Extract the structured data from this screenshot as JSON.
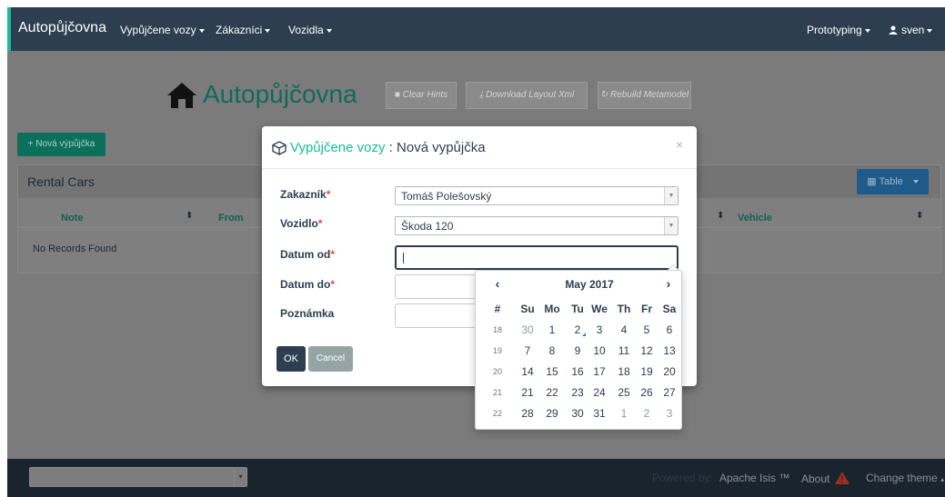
{
  "navbar": {
    "brand": "Autopůjčovna",
    "menus": [
      "Vypůjčene vozy",
      "Zákazníci",
      "Vozidla"
    ],
    "right": {
      "prototyping": "Prototyping",
      "user": "sven"
    }
  },
  "header": {
    "title": "Autopůjčovna",
    "buttons": [
      "Clear Hints",
      "Download Layout Xml",
      "Rebuild Metamodel"
    ]
  },
  "actions": {
    "nova": "Nová výpůjčka"
  },
  "panel": {
    "title": "Rental Cars",
    "view_button": "Table",
    "columns": [
      "Note",
      "From",
      "Vehicle"
    ],
    "empty": "No Records Found"
  },
  "modal": {
    "title_link": "Vypůjčene vozy",
    "title_rest": " : Nová vypůjčka",
    "close": "×",
    "fields": {
      "zakaznik": {
        "label": "Zakazník",
        "value": "Tomáš Polešovský"
      },
      "vozidlo": {
        "label": "Vozidlo",
        "value": "Škoda 120"
      },
      "datum_od": {
        "label": "Datum od",
        "value": ""
      },
      "datum_do": {
        "label": "Datum do",
        "value": ""
      },
      "poznamka": {
        "label": "Poznámka",
        "value": ""
      }
    },
    "required_mark": "*",
    "ok": "OK",
    "cancel": "Cancel"
  },
  "datepicker": {
    "month": "May 2017",
    "prev": "‹",
    "next": "›",
    "headers": [
      "#",
      "Su",
      "Mo",
      "Tu",
      "We",
      "Th",
      "Fr",
      "Sa"
    ],
    "weeks": [
      {
        "week": "18",
        "days": [
          "30",
          "1",
          "2",
          "3",
          "4",
          "5",
          "6"
        ]
      },
      {
        "week": "19",
        "days": [
          "7",
          "8",
          "9",
          "10",
          "11",
          "12",
          "13"
        ]
      },
      {
        "week": "20",
        "days": [
          "14",
          "15",
          "16",
          "17",
          "18",
          "19",
          "20"
        ]
      },
      {
        "week": "21",
        "days": [
          "21",
          "22",
          "23",
          "24",
          "25",
          "26",
          "27"
        ]
      },
      {
        "week": "22",
        "days": [
          "28",
          "29",
          "30",
          "31",
          "1",
          "2",
          "3"
        ]
      }
    ],
    "today": "2"
  },
  "footer": {
    "powered": "Powered by:",
    "apache": "Apache Isis ™",
    "about": "About",
    "theme": "Change theme"
  },
  "colors": {
    "brand": "#2c3e50",
    "accent": "#18bc9c",
    "danger": "#e74c3c"
  }
}
